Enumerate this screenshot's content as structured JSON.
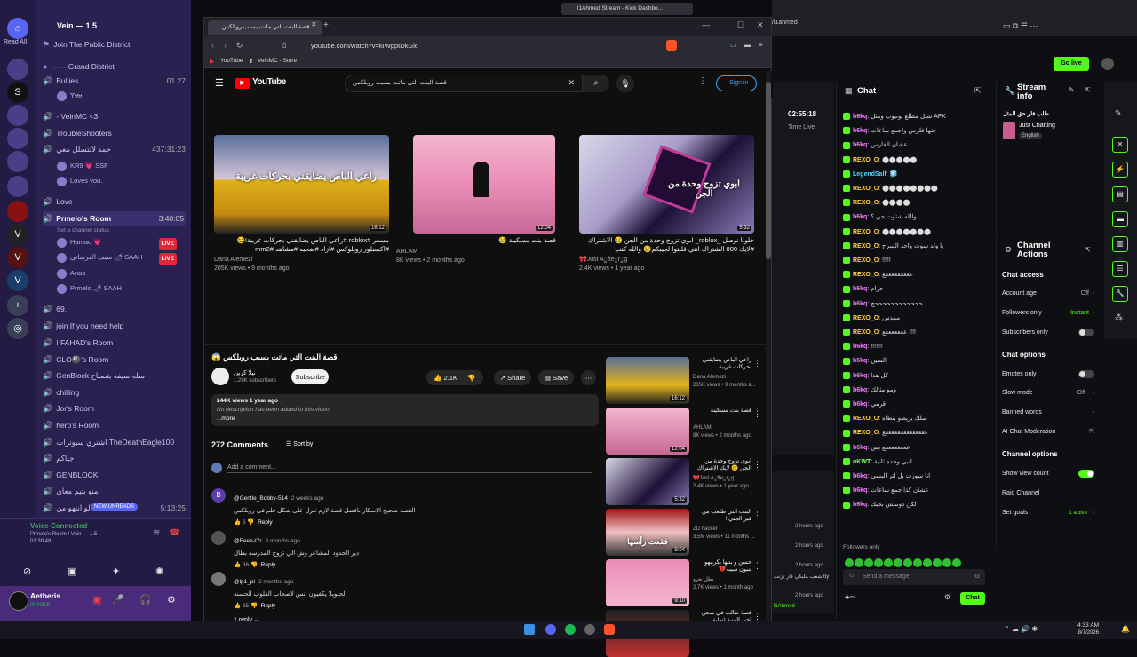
{
  "discord": {
    "server_name": "Vein — 1.5",
    "read_all": "Read All",
    "channels": [
      {
        "label": "Join The Public District",
        "y": 0
      },
      {
        "label": "—— Grand District"
      },
      {
        "label": "Bullies",
        "count": "01  27"
      },
      {
        "label": "Ɏᵾᵾ"
      },
      {
        "label": "- VeinMC <3"
      },
      {
        "label": "TroubleShooters"
      },
      {
        "label": "حمد لاتتسلل معي",
        "time": "437:31:23"
      },
      {
        "label": "KR9  💗 SSF"
      },
      {
        "label": "Loves you."
      },
      {
        "label": "Love"
      },
      {
        "label": "Prmelo's Room",
        "time": "3:40:05"
      },
      {
        "label": "Set a channel status"
      },
      {
        "label": "Hamad 💗",
        "live": "LIVE"
      },
      {
        "label": "سيف العرساني  🌶 SAAH",
        "live": "LIVE"
      },
      {
        "label": "Anas"
      },
      {
        "label": "Prmelo  🌶 SAAH"
      },
      {
        "label": "69."
      },
      {
        "label": "join If you need help"
      },
      {
        "label": "! FAHAD's Room"
      },
      {
        "label": "CLO🎱's Room"
      },
      {
        "label": "GenBlock سله سيفه بتصباح"
      },
      {
        "label": "chilling"
      },
      {
        "label": "Jor's Room"
      },
      {
        "label": "ħero's Room"
      },
      {
        "label": "اشتري سيونرات TheDeathEagle100"
      },
      {
        "label": "جياكم"
      },
      {
        "label": "GENBLOCK"
      },
      {
        "label": "منو بتيم معاي"
      },
      {
        "label": "الو انتهو من",
        "time": "5:13:25"
      }
    ],
    "new_unreads": "NEW UNREADS",
    "voice": {
      "status": "Voice Connected",
      "room": "Prmelo's Room / Vein — 1.5",
      "time": "03:39:48"
    },
    "user": {
      "name": "Aetheris",
      "status": "In voice"
    }
  },
  "browser": {
    "tabs": [
      {
        "label": "قصة البنت التي ماتت بسبب روبلكس",
        "active": true
      },
      {
        "label": "l1Ahmed Stream - Kick Dashbo..."
      }
    ],
    "url": "youtube.com/watch?v=kIWpptDkGlc",
    "bookmarks": [
      "YouTube",
      "VeinMC - Store"
    ],
    "search_query": "قصة البنت التي ماتت بسبب روبلكس",
    "signin": "Sign in"
  },
  "youtube": {
    "top_videos": [
      {
        "title": "مسفر #roblox #راعي الباص يضايقني بحركات غريبة!😂 #اكسبلور روبلوكس #ازاد #ضحيه #مشاهد #mm2",
        "channel": "Dana Alemezi",
        "meta": "205K views • 9 months ago",
        "duration": "16:12",
        "thumb_text": "راعي الباص يضايقني بحركات غريبة"
      },
      {
        "title": "قصة بنت مسكينة 😢",
        "channel": "AHLAM",
        "meta": "8K views • 2 months ago",
        "duration": "12:04",
        "thumb_text": ""
      },
      {
        "title": "خلونا نوصل _roblox_ ابوي تزوج وحدة من الجن 😢 الاشتراك #لايك 800 الشتراك انتي قلبتوا لجيبكم😢 والله كتب",
        "channel": "🎀Just Aॗfteॗrॗg",
        "meta": "2.4K views • 1 year ago",
        "duration": "5:32",
        "thumb_text": "ابوي تزوج وحدة من الجن"
      }
    ],
    "main": {
      "title": "قصة البنت التي ماتت بسبب روبلكس 😱",
      "channel": "نيلا كرين",
      "subs": "1.28K subscribers",
      "subscribe": "Subscribe",
      "likes": "2.1K",
      "share": "Share",
      "save": "Save",
      "views": "244K views  1 year ago",
      "desc": "No description has been added to this video.",
      "more": "...more",
      "comments_count": "272 Comments",
      "sort_by": "Sort by",
      "add_comment": "Add a comment..."
    },
    "comments": [
      {
        "name": "@Gentle_Bobby-514",
        "time": "2 weeks ago",
        "text": "القصة صحيح الاسكار بافضل قصة لازم تنزل على شكل فلم في روبلكس",
        "likes": "6",
        "reply": "Reply"
      },
      {
        "name": "@Eeee-t7r",
        "time": "8 months ago",
        "text": "دير الحدود المشاعر وش الي تزوج المدرسه بطال",
        "likes": "36",
        "reply": "Reply"
      },
      {
        "name": "@lp1_pl",
        "time": "2 months ago",
        "text": "الحلويلا يكفيون انس لاصحاب القلوب الحسنه",
        "likes": "35",
        "reply": "Reply"
      }
    ],
    "replies": "1 reply",
    "sidebar": [
      {
        "title": "راعي الباص يضايقني بحركات غريبة",
        "channel": "Dana Alemezi",
        "meta": "205K views • 9 months a...",
        "duration": "16:12"
      },
      {
        "title": "قصة بنت مسكينة",
        "channel": "AHLAM",
        "meta": "8K views • 2 months ago",
        "duration": "12:04"
      },
      {
        "title": "ابوي تزوج وحدة من الجن 😢 لايك الاشتراك ...",
        "channel": "🎀Just Aॗfteॗrॗg",
        "meta": "2.4K views • 1 year ago",
        "duration": "5:32"
      },
      {
        "title": "البنت التي طلعت من قبر الجني!!",
        "channel": "ZD hacker",
        "meta": "3.5M views • 11 months ...",
        "duration": "9:04",
        "thumb_text": "فقعت رأسها"
      },
      {
        "title": "حسن و بنتها بكرمهو بنيون سيبه💔",
        "channel": "بطل نعرو",
        "meta": "2.7K views • 1 month ago",
        "duration": "9:10"
      },
      {
        "title": "قصة طالب في سجن اخي الفنية (نهاية مأساوية)",
        "channel": "",
        "meta": "",
        "duration": ""
      }
    ]
  },
  "kick": {
    "stream_time": "02:55:18",
    "time_live": "Time Live",
    "go_live": "Go live",
    "chat_title": "Chat",
    "stream_info_title": "Stream info",
    "stream_info_tag": "طلب فلر حق المثل",
    "category": "Just Chatting",
    "language": "English",
    "chat_lines": [
      {
        "user": "b6kq",
        "text": "شبل مطلع يوتيوب ومثل AFK"
      },
      {
        "user": "b6kq",
        "text": "حتها فلرس واجمع ساعات"
      },
      {
        "user": "b6kq",
        "text": "عشان الفارس"
      },
      {
        "user": "REXO_O",
        "text": "⬤⬤⬤⬤⬤"
      },
      {
        "user": "LegendSalf",
        "text": "🧊"
      },
      {
        "user": "REXO_O",
        "text": "⬤⬤⬤⬤⬤⬤⬤⬤"
      },
      {
        "user": "REXO_O",
        "text": "⬤⬤⬤⬤"
      },
      {
        "user": "b6kq",
        "text": "والله شتوت جي ؟"
      },
      {
        "user": "REXO_O",
        "text": "⬤⬤⬤⬤⬤⬤⬤"
      },
      {
        "user": "REXO_O",
        "text": "يا ولد سوت واحد السرح"
      },
      {
        "user": "REXO_O",
        "text": "!!!!!"
      },
      {
        "user": "REXO_O",
        "text": "عععععععععع"
      },
      {
        "user": "b6kq",
        "text": "حرام"
      },
      {
        "user": "b6kq",
        "text": "ححححححححححححح"
      },
      {
        "user": "REXO_O",
        "text": "ممدس"
      },
      {
        "user": "REXO_O",
        "text": "عععععععع !!!!"
      },
      {
        "user": "b6kq",
        "text": "!!!!!!!"
      },
      {
        "user": "b6kq",
        "text": "السين"
      },
      {
        "user": "b6kq",
        "text": "كل هذا"
      },
      {
        "user": "b6kq",
        "text": "ومو مثالك"
      },
      {
        "user": "b6kq",
        "text": "قرمي"
      },
      {
        "user": "REXO_O",
        "text": "سلك بريطو بنطاه"
      },
      {
        "user": "REXO_O",
        "text": "ععععععععععععععع"
      },
      {
        "user": "b6kq",
        "text": "ععععععععع بس"
      },
      {
        "user": "uKWT",
        "text": "انبي وحده ثانية"
      },
      {
        "user": "b6kq",
        "text": "انا سورت بل لتر البسي"
      },
      {
        "user": "b6kq",
        "text": "عشان كذا جمع ساعات"
      },
      {
        "user": "b6kq",
        "text": "لكن دونتبش بجيك"
      }
    ],
    "followers_only_label": "Followers only",
    "send_placeholder": "Send a message",
    "chat_button": "Chat",
    "channel_actions_title": "Channel Actions",
    "chat_access": "Chat access",
    "account_age": {
      "label": "Account age",
      "value": "Off"
    },
    "followers_only": {
      "label": "Followers only",
      "value": "Instant"
    },
    "subscribers_only": {
      "label": "Subscribers only"
    },
    "chat_options": "Chat options",
    "emotes_only": {
      "label": "Emotes only"
    },
    "slow_mode": {
      "label": "Slow mode",
      "value": "Off"
    },
    "banned_words": {
      "label": "Banned words"
    },
    "ai_moderation": {
      "label": "AI Chat Moderation"
    },
    "channel_options": "Channel options",
    "show_view_count": {
      "label": "Show view count"
    },
    "raid_channel": {
      "label": "Raid Channel"
    },
    "set_goals": {
      "label": "Set goals",
      "value": "1 active"
    },
    "small_panel": [
      "2 hours ago",
      "2 hours ago",
      "2 hours ago",
      "شعب مليكي فار تزتب by",
      "2 hours ago",
      "l1Ahmed"
    ]
  },
  "taskbar": {
    "time": "4:33 AM",
    "date": "8/7/2026"
  }
}
